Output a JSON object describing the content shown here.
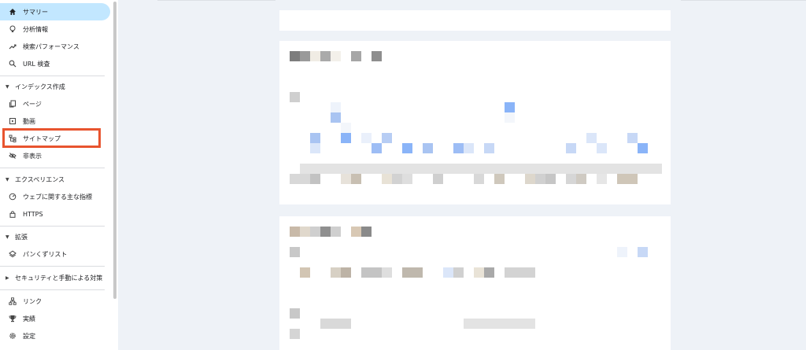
{
  "sidebar": {
    "items": [
      {
        "label": "サマリー",
        "icon": "home-icon"
      },
      {
        "label": "分析情報",
        "icon": "lightbulb-icon"
      },
      {
        "label": "検索パフォーマンス",
        "icon": "trending-up-icon"
      },
      {
        "label": "URL 検査",
        "icon": "search-icon"
      }
    ],
    "sections": [
      {
        "label": "インデックス作成",
        "items": [
          {
            "label": "ページ",
            "icon": "pages-icon"
          },
          {
            "label": "動画",
            "icon": "video-icon"
          },
          {
            "label": "サイトマップ",
            "icon": "sitemap-icon"
          },
          {
            "label": "非表示",
            "icon": "eye-off-icon"
          }
        ]
      },
      {
        "label": "エクスペリエンス",
        "items": [
          {
            "label": "ウェブに関する主な指標",
            "icon": "gauge-icon"
          },
          {
            "label": "HTTPS",
            "icon": "lock-icon"
          }
        ]
      },
      {
        "label": "拡張",
        "items": [
          {
            "label": "パンくずリスト",
            "icon": "layers-icon"
          }
        ]
      },
      {
        "label": "セキュリティと手動による対策",
        "items": []
      }
    ],
    "bottom_items": [
      {
        "label": "リンク",
        "icon": "links-icon"
      },
      {
        "label": "実績",
        "icon": "trophy-icon"
      },
      {
        "label": "設定",
        "icon": "gear-icon"
      }
    ]
  },
  "colors": {
    "active_bg": "#c2e7ff",
    "highlight": "#e8542f",
    "accent_blue": "#8ab4f8"
  }
}
